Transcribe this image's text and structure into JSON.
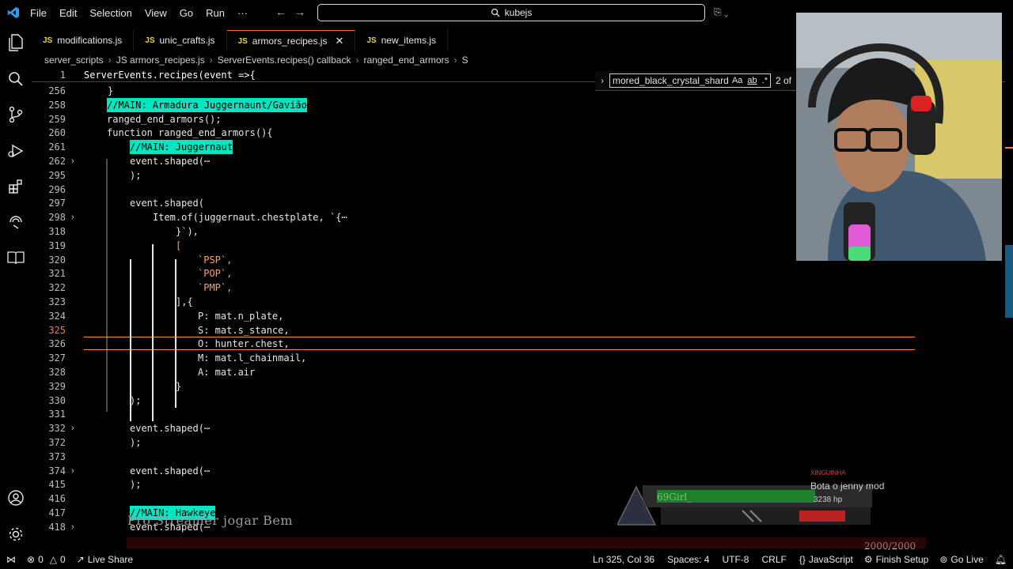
{
  "window": {
    "menu": [
      "File",
      "Edit",
      "Selection",
      "View",
      "Go",
      "Run",
      "···"
    ],
    "search": "kubejs"
  },
  "tabs": [
    {
      "label": "modifications.js",
      "type": "JS",
      "active": false
    },
    {
      "label": "unic_crafts.js",
      "type": "JS",
      "active": false
    },
    {
      "label": "armors_recipes.js",
      "type": "JS",
      "active": true
    },
    {
      "label": "new_items.js",
      "type": "JS",
      "active": false
    }
  ],
  "breadcrumb": [
    "server_scripts",
    "JS armors_recipes.js",
    "ServerEvents.recipes() callback",
    "ranged_end_armors",
    "S"
  ],
  "find": {
    "value": "mored_black_crystal_shard",
    "case": "Aa",
    "word": "ab",
    "regex": ".*",
    "count": "2 of"
  },
  "editor": {
    "sticky": {
      "line": "1",
      "text": "ServerEvents.recipes(event =>{"
    },
    "lines": [
      {
        "n": "256",
        "text": "}"
      },
      {
        "n": "258",
        "text": "//MAIN: Armadura Juggernaunt/Gavião"
      },
      {
        "n": "259",
        "text": "ranged_end_armors();"
      },
      {
        "n": "260",
        "text": "function ranged_end_armors(){"
      },
      {
        "n": "261",
        "text": "//MAIN: Juggernaut"
      },
      {
        "n": "262",
        "text": "event.shaped(⋯"
      },
      {
        "n": "295",
        "text": ");"
      },
      {
        "n": "296",
        "text": ""
      },
      {
        "n": "297",
        "text": "event.shaped("
      },
      {
        "n": "298",
        "text": "Item.of(juggernaut.chestplate, `{⋯"
      },
      {
        "n": "318",
        "text": "}`),"
      },
      {
        "n": "319",
        "text": "["
      },
      {
        "n": "320",
        "text": "`PSP`,"
      },
      {
        "n": "321",
        "text": "`POP`,"
      },
      {
        "n": "322",
        "text": "`PMP`,"
      },
      {
        "n": "323",
        "text": "],{"
      },
      {
        "n": "324",
        "text": "P: mat.n_plate,"
      },
      {
        "n": "325",
        "text": "S: mat.s_stance,"
      },
      {
        "n": "326",
        "text": "O: hunter.chest,"
      },
      {
        "n": "327",
        "text": "M: mat.l_chainmail,"
      },
      {
        "n": "328",
        "text": "A: mat.air"
      },
      {
        "n": "329",
        "text": "}"
      },
      {
        "n": "330",
        "text": ");"
      },
      {
        "n": "331",
        "text": ""
      },
      {
        "n": "332",
        "text": "event.shaped(⋯"
      },
      {
        "n": "372",
        "text": ");"
      },
      {
        "n": "373",
        "text": ""
      },
      {
        "n": "374",
        "text": "event.shaped(⋯"
      },
      {
        "n": "415",
        "text": ");"
      },
      {
        "n": "416",
        "text": ""
      },
      {
        "n": "417",
        "text": "//MAIN: Hawkeye"
      },
      {
        "n": "418",
        "text": "event.shaped(⋯"
      }
    ]
  },
  "stream_overlay": {
    "caption": "Pro Streamer jogar Bem",
    "player": "69Girl_",
    "chat_user": "XINGUINHA",
    "chat_message": "Bota o jenny mod",
    "hp": "3238 hp",
    "mana": "2000/2000"
  },
  "statusbar": {
    "errors": "0",
    "warnings": "0",
    "live_share": "Live Share",
    "position": "Ln 325, Col 36",
    "spaces": "Spaces: 4",
    "encoding": "UTF-8",
    "eol": "CRLF",
    "language": "JavaScript",
    "finish_setup": "Finish Setup",
    "go_live": "Go Live"
  },
  "colors": {
    "accent": "#ff6a3d",
    "highlight": "#00e6c3",
    "js": "#f0d54a"
  }
}
